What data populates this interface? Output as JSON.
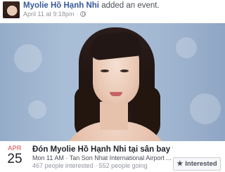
{
  "post": {
    "author": "Myolie Hồ Hạnh Nhi",
    "action": "added an event.",
    "timestamp": "April 11 at 9:18pm",
    "privacy_icon": "globe-icon"
  },
  "event": {
    "month": "APR",
    "day": "25",
    "title": "Đón Myolie Hồ Hạnh Nhi tại sân bay v...",
    "when_where": "Mon 11 AM · Tan Son Nhat International Airport ...",
    "stats": "467 people interested · 552 people going",
    "interested_label": "Interested",
    "interested_icon": "star-icon",
    "month_color": "#e0393e"
  },
  "colors": {
    "author_link": "#365899",
    "muted": "#90949c"
  }
}
